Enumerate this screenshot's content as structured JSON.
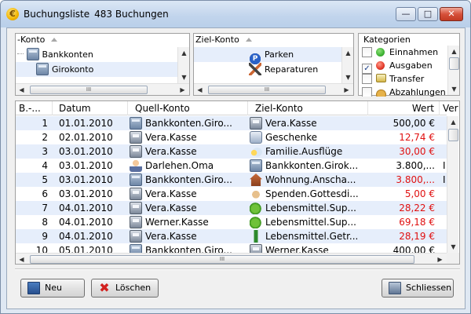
{
  "window": {
    "title": "Buchungsliste",
    "count": "483 Buchungen",
    "app_icon": "euro-coin-icon"
  },
  "filters": {
    "source": {
      "header": "-Konto",
      "items": [
        {
          "label": "Bankkonten",
          "icon": "bank-icon"
        },
        {
          "label": "Girokonto",
          "icon": "bank-icon"
        }
      ]
    },
    "target": {
      "header": "Ziel-Konto",
      "items": [
        {
          "label": "Parken",
          "icon": "parking-icon"
        },
        {
          "label": "Reparaturen",
          "icon": "tools-icon"
        }
      ]
    },
    "categories": {
      "header": "Kategorien",
      "items": [
        {
          "label": "Einnahmen",
          "checked": false,
          "color": "#3fb435"
        },
        {
          "label": "Ausgaben",
          "checked": true,
          "color": "#e33a2a"
        },
        {
          "label": "Transfer",
          "checked": false,
          "icon": "money-icon"
        },
        {
          "label": "Abzahlungen",
          "checked": false,
          "icon": "sack-icon"
        }
      ]
    }
  },
  "table": {
    "columns": [
      "B.-...",
      "Datum",
      "Quell-Konto",
      "Ziel-Konto",
      "Wert",
      "Ver"
    ],
    "rows": [
      {
        "nr": "1",
        "date": "01.01.2010",
        "source": "Bankkonten.Giro...",
        "source_icon": "bank-icon",
        "target": "Vera.Kasse",
        "target_icon": "cash-icon",
        "value": "500,00 €",
        "negative": false,
        "extra": ""
      },
      {
        "nr": "2",
        "date": "02.01.2010",
        "source": "Vera.Kasse",
        "source_icon": "cash-icon",
        "target": "Geschenke",
        "target_icon": "gift-icon",
        "value": "12,74 €",
        "negative": true,
        "extra": ""
      },
      {
        "nr": "3",
        "date": "03.01.2010",
        "source": "Vera.Kasse",
        "source_icon": "cash-icon",
        "target": "Familie.Ausflüge",
        "target_icon": "cloud-icon",
        "value": "30,00 €",
        "negative": true,
        "extra": ""
      },
      {
        "nr": "4",
        "date": "03.01.2010",
        "source": "Darlehen.Oma",
        "source_icon": "person-icon",
        "target": "Bankkonten.Girok...",
        "target_icon": "bank-icon",
        "value": "3.800,...",
        "negative": false,
        "extra": "I"
      },
      {
        "nr": "5",
        "date": "03.01.2010",
        "source": "Bankkonten.Giro...",
        "source_icon": "bank-icon",
        "target": "Wohnung.Anscha...",
        "target_icon": "house-icon",
        "value": "3.800,...",
        "negative": true,
        "extra": "I"
      },
      {
        "nr": "6",
        "date": "03.01.2010",
        "source": "Vera.Kasse",
        "source_icon": "cash-icon",
        "target": "Spenden.Gottesdi...",
        "target_icon": "hands-icon",
        "value": "5,00 €",
        "negative": true,
        "extra": ""
      },
      {
        "nr": "7",
        "date": "04.01.2010",
        "source": "Vera.Kasse",
        "source_icon": "cash-icon",
        "target": "Lebensmittel.Sup...",
        "target_icon": "apple-icon",
        "value": "28,22 €",
        "negative": true,
        "extra": ""
      },
      {
        "nr": "8",
        "date": "04.01.2010",
        "source": "Werner.Kasse",
        "source_icon": "cash-icon",
        "target": "Lebensmittel.Sup...",
        "target_icon": "apple-icon",
        "value": "69,18 €",
        "negative": true,
        "extra": ""
      },
      {
        "nr": "9",
        "date": "04.01.2010",
        "source": "Vera.Kasse",
        "source_icon": "cash-icon",
        "target": "Lebensmittel.Getr...",
        "target_icon": "bottle-icon",
        "value": "28,19 €",
        "negative": true,
        "extra": ""
      },
      {
        "nr": "10",
        "date": "05.01.2010",
        "source": "Bankkonten.Giro...",
        "source_icon": "bank-icon",
        "target": "Werner.Kasse",
        "target_icon": "cash-icon",
        "value": "400,00 €",
        "negative": false,
        "extra": ""
      }
    ]
  },
  "buttons": {
    "new": "Neu",
    "delete": "Löschen",
    "close": "Schliessen"
  },
  "scroll_thumb_glyph": "III",
  "colors": {
    "selection": "#e6eefb",
    "negative_value": "#e01010",
    "title_bar": "#c1d4ec"
  }
}
